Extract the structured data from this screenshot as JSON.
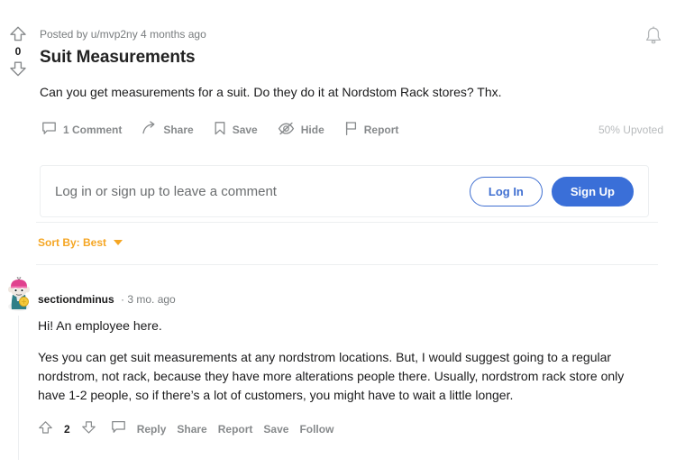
{
  "post": {
    "score": "0",
    "byline": "Posted by u/mvp2ny 4 months ago",
    "title": "Suit Measurements",
    "body": "Can you get measurements for a suit. Do they do it at Nordstom Rack stores? Thx.",
    "upvoted": "50% Upvoted",
    "actions": [
      {
        "label": "1 Comment",
        "icon": "comment-icon"
      },
      {
        "label": "Share",
        "icon": "share-icon"
      },
      {
        "label": "Save",
        "icon": "bookmark-icon"
      },
      {
        "label": "Hide",
        "icon": "eye-slash-icon"
      },
      {
        "label": "Report",
        "icon": "flag-icon"
      }
    ]
  },
  "notification": {
    "icon": "bell-icon"
  },
  "login": {
    "prompt": "Log in or sign up to leave a comment",
    "login_label": "Log In",
    "signup_label": "Sign Up"
  },
  "sort": {
    "label": "Sort By: Best",
    "icon": "chevron-down-icon"
  },
  "comment": {
    "author": "sectiondminus",
    "meta": "· 3 mo. ago",
    "paragraphs": [
      "Hi! An employee here.",
      "Yes you can get suit measurements at any nordstrom locations. But, I would suggest going to a regular nordstrom, not rack, because they have more alterations people there. Usually, nordstrom rack store only have 1-2 people, so if there’s a lot of customers, you might have to wait a little longer."
    ],
    "score": "2",
    "actions": [
      "Reply",
      "Share",
      "Report",
      "Save",
      "Follow"
    ]
  },
  "colors": {
    "accent_orange": "#f5a623",
    "brand_blue": "#3a6fd8",
    "muted": "#878a8c"
  }
}
